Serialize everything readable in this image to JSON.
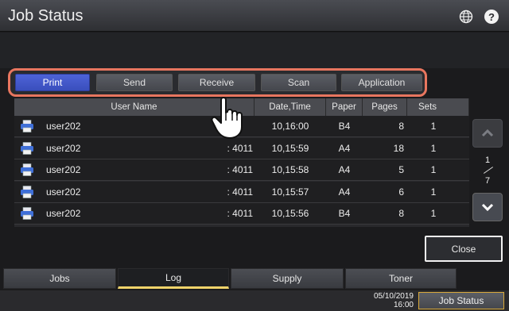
{
  "title": "Job Status",
  "help_label": "?",
  "filters": {
    "print": "Print",
    "send": "Send",
    "receive": "Receive",
    "scan": "Scan",
    "application": "Application",
    "active": "Print"
  },
  "columns": {
    "user_name": "User Name",
    "date_time": "Date,Time",
    "paper": "Paper",
    "pages": "Pages",
    "sets": "Sets"
  },
  "rows": [
    {
      "icon": "printer-icon",
      "user": "user202",
      "port": "",
      "date": "10,16:00",
      "paper": "B4",
      "pages": "8",
      "sets": "1"
    },
    {
      "icon": "printer-icon",
      "user": "user202",
      "port": ": 4011",
      "date": "10,15:59",
      "paper": "A4",
      "pages": "18",
      "sets": "1"
    },
    {
      "icon": "printer-icon",
      "user": "user202",
      "port": ": 4011",
      "date": "10,15:58",
      "paper": "A4",
      "pages": "5",
      "sets": "1"
    },
    {
      "icon": "printer-icon",
      "user": "user202",
      "port": ": 4011",
      "date": "10,15:57",
      "paper": "A4",
      "pages": "6",
      "sets": "1"
    },
    {
      "icon": "printer-icon",
      "user": "user202",
      "port": ": 4011",
      "date": "10,15:56",
      "paper": "B4",
      "pages": "8",
      "sets": "1"
    }
  ],
  "pager": {
    "current": "1",
    "total": "7"
  },
  "close_label": "Close",
  "tabs": {
    "jobs": "Jobs",
    "log": "Log",
    "supply": "Supply",
    "toner": "Toner",
    "active": "Log"
  },
  "status_bar": {
    "date": "05/10/2019",
    "time": "16:00",
    "job_status": "Job Status"
  },
  "colors": {
    "accent": "#3a4fbc",
    "highlight": "#e8765f",
    "tab_active": "#f0d36a"
  }
}
